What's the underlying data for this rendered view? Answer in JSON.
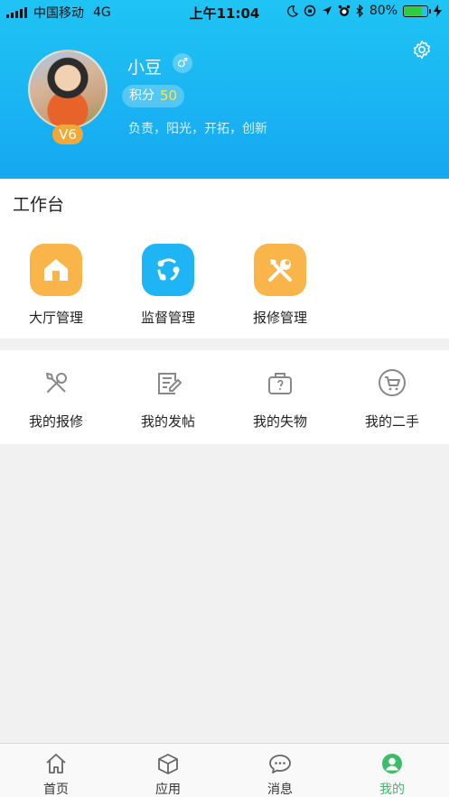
{
  "status": {
    "carrier": "中国移动",
    "network": "4G",
    "time": "上午11:04",
    "battery": "80%"
  },
  "profile": {
    "name": "小豆",
    "gender_symbol": "♂",
    "points_label": "积分",
    "points_value": "50",
    "level": "V6",
    "motto": "负责，阳光，开拓，创新"
  },
  "workbench": {
    "title": "工作台",
    "items": [
      {
        "label": "大厅管理",
        "icon": "house-icon",
        "color": "#f9b44a"
      },
      {
        "label": "监督管理",
        "icon": "share-cycle-icon",
        "color": "#1fb4f4"
      },
      {
        "label": "报修管理",
        "icon": "tools-icon",
        "color": "#f9b44a"
      }
    ]
  },
  "mine": {
    "items": [
      {
        "label": "我的报修",
        "icon": "tools-icon"
      },
      {
        "label": "我的发帖",
        "icon": "edit-post-icon"
      },
      {
        "label": "我的失物",
        "icon": "lost-bag-icon"
      },
      {
        "label": "我的二手",
        "icon": "cart-icon"
      }
    ]
  },
  "tabs": [
    {
      "label": "首页",
      "icon": "home-icon"
    },
    {
      "label": "应用",
      "icon": "cube-icon"
    },
    {
      "label": "消息",
      "icon": "chat-icon"
    },
    {
      "label": "我的",
      "icon": "user-icon",
      "active": true
    }
  ],
  "colors": {
    "header": "#1fb4f4",
    "accent_green": "#3cbd6a",
    "badge": "#efa93a",
    "points": "#ffe34a"
  }
}
